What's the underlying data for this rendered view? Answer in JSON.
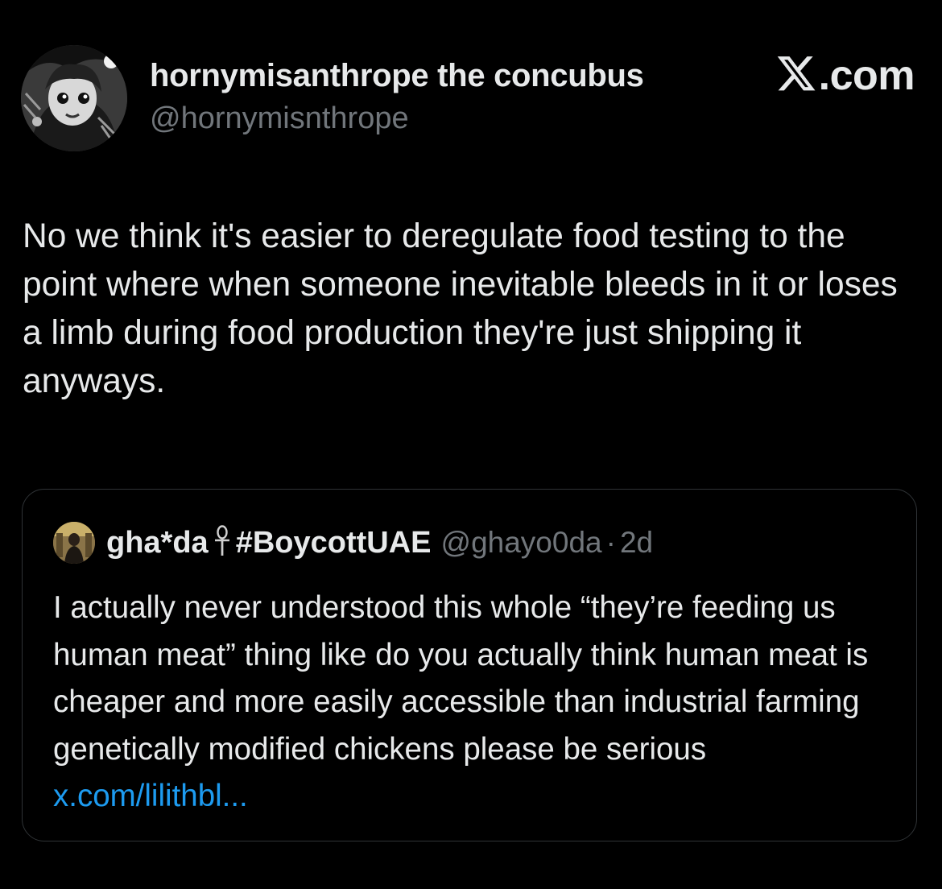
{
  "author": {
    "display_name": "hornymisanthrope the concubus",
    "handle": "@hornymisnthrope"
  },
  "brand": {
    "text": ".com",
    "icon": "x-logo-icon"
  },
  "tweet": {
    "text": "No we think it's easier to deregulate food testing to the point where when someone inevitable bleeds in it or loses a limb during food production they're just shipping it anyways."
  },
  "quoted_tweet": {
    "display_name": "gha*da",
    "name_icon": "ankh-icon",
    "hashtag": "#BoycottUAE",
    "handle": "@ghayo0da",
    "separator": "·",
    "time": "2d",
    "text": "I actually never understood this whole “they’re feeding us human meat” thing like do you actually think human meat is cheaper and more easily accessible than industrial farming genetically modified chickens please be serious",
    "link": "x.com/lilithbl..."
  },
  "colors": {
    "background": "#000000",
    "text_primary": "#e7e9ea",
    "text_secondary": "#71767b",
    "link": "#1d9bf0",
    "border": "#2f3336"
  }
}
